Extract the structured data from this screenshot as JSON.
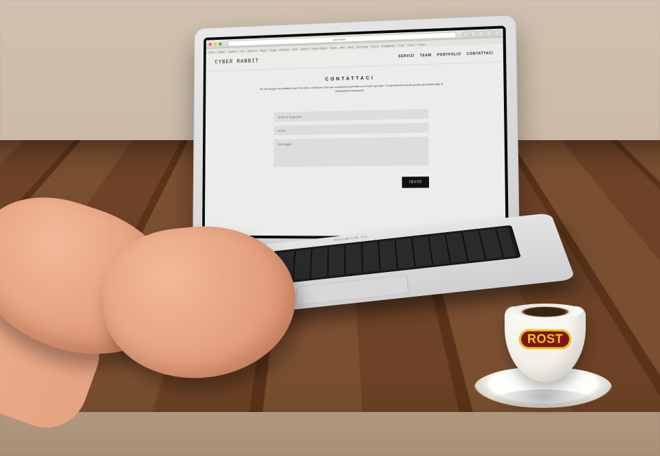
{
  "browser": {
    "address": "cyberrabbit",
    "bookmarks": [
      "Artisti",
      "Asfalto",
      "Casillero",
      "Fico",
      "Mythene",
      "Magic",
      "Viaggi",
      "weSpeak",
      "MCS",
      "Asknet",
      "Torrent Butler",
      "Subito",
      "Attis",
      "Blog",
      "Streaming",
      "Tonus!",
      "Engagebox",
      "Poke",
      "Turon!",
      "Poster"
    ]
  },
  "site": {
    "logo": "CYBER RABBIT",
    "nav": {
      "servizi": "SERVIZI",
      "team": "TEAM",
      "portfolio": "PORTFOLIO",
      "contattaci": "CONTATTACI"
    },
    "hero": {
      "title": "CONTATTACI",
      "copy": "Se hai bisogno di contattarci per il tuo sito o anche per solo una consulenza puoi farlo con il form qui sotto. Ti risponderemo al più presto per fornirti tutte le informazioni necessarie."
    },
    "form": {
      "name_ph": "Nome e Cognome",
      "email_ph": "Email",
      "message_ph": "Messaggio",
      "submit": "INVIO"
    }
  },
  "laptop": {
    "brand": "MacBook Air"
  },
  "cup": {
    "logo": "ROST"
  }
}
